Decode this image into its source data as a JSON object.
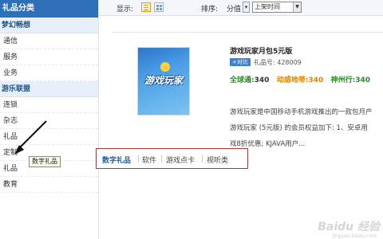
{
  "sidebar": {
    "header": "礼品分类",
    "groups": [
      {
        "label": "梦幻畅想",
        "items": [
          "通信",
          "服务",
          "业务"
        ]
      },
      {
        "label": "游乐联盟",
        "items": [
          "连锁",
          "杂志",
          "礼品",
          "定制",
          "礼品",
          "教育"
        ]
      }
    ]
  },
  "toolbar": {
    "display_label": "显示:",
    "sort_label": "排序:",
    "sort_value": "分值",
    "sort_select": "上架时间"
  },
  "product": {
    "title": "游戏玩家月包5元版",
    "compare_button": "+对比",
    "gift_no": "礼品号: 428009",
    "prices": [
      {
        "label": "全球通:",
        "value": "340"
      },
      {
        "label": "动感地带:",
        "value": "340"
      },
      {
        "label": "神州行:",
        "value": "340"
      }
    ],
    "description": [
      "游戏玩家是中国移动手机游戏推出的一款包月产",
      "游戏玩家 (5元版) 的会员权益加下: 1、安卓用",
      "戏8折优惠; KJAVA用户..."
    ],
    "image_logo_text": "游戏玩家"
  },
  "popup": {
    "items": [
      "数字礼品",
      "软件",
      "游戏点卡",
      "视听类"
    ]
  },
  "tooltip": "数字礼品",
  "watermark": "Baidu 经验",
  "watermark_sub": "jingyan.baidu.com",
  "colors": {
    "sidebar_header_bg": "#2e70b8",
    "popup_border": "#a63b3b",
    "price_green": "#2a8a2a",
    "price_orange": "#e38400"
  }
}
